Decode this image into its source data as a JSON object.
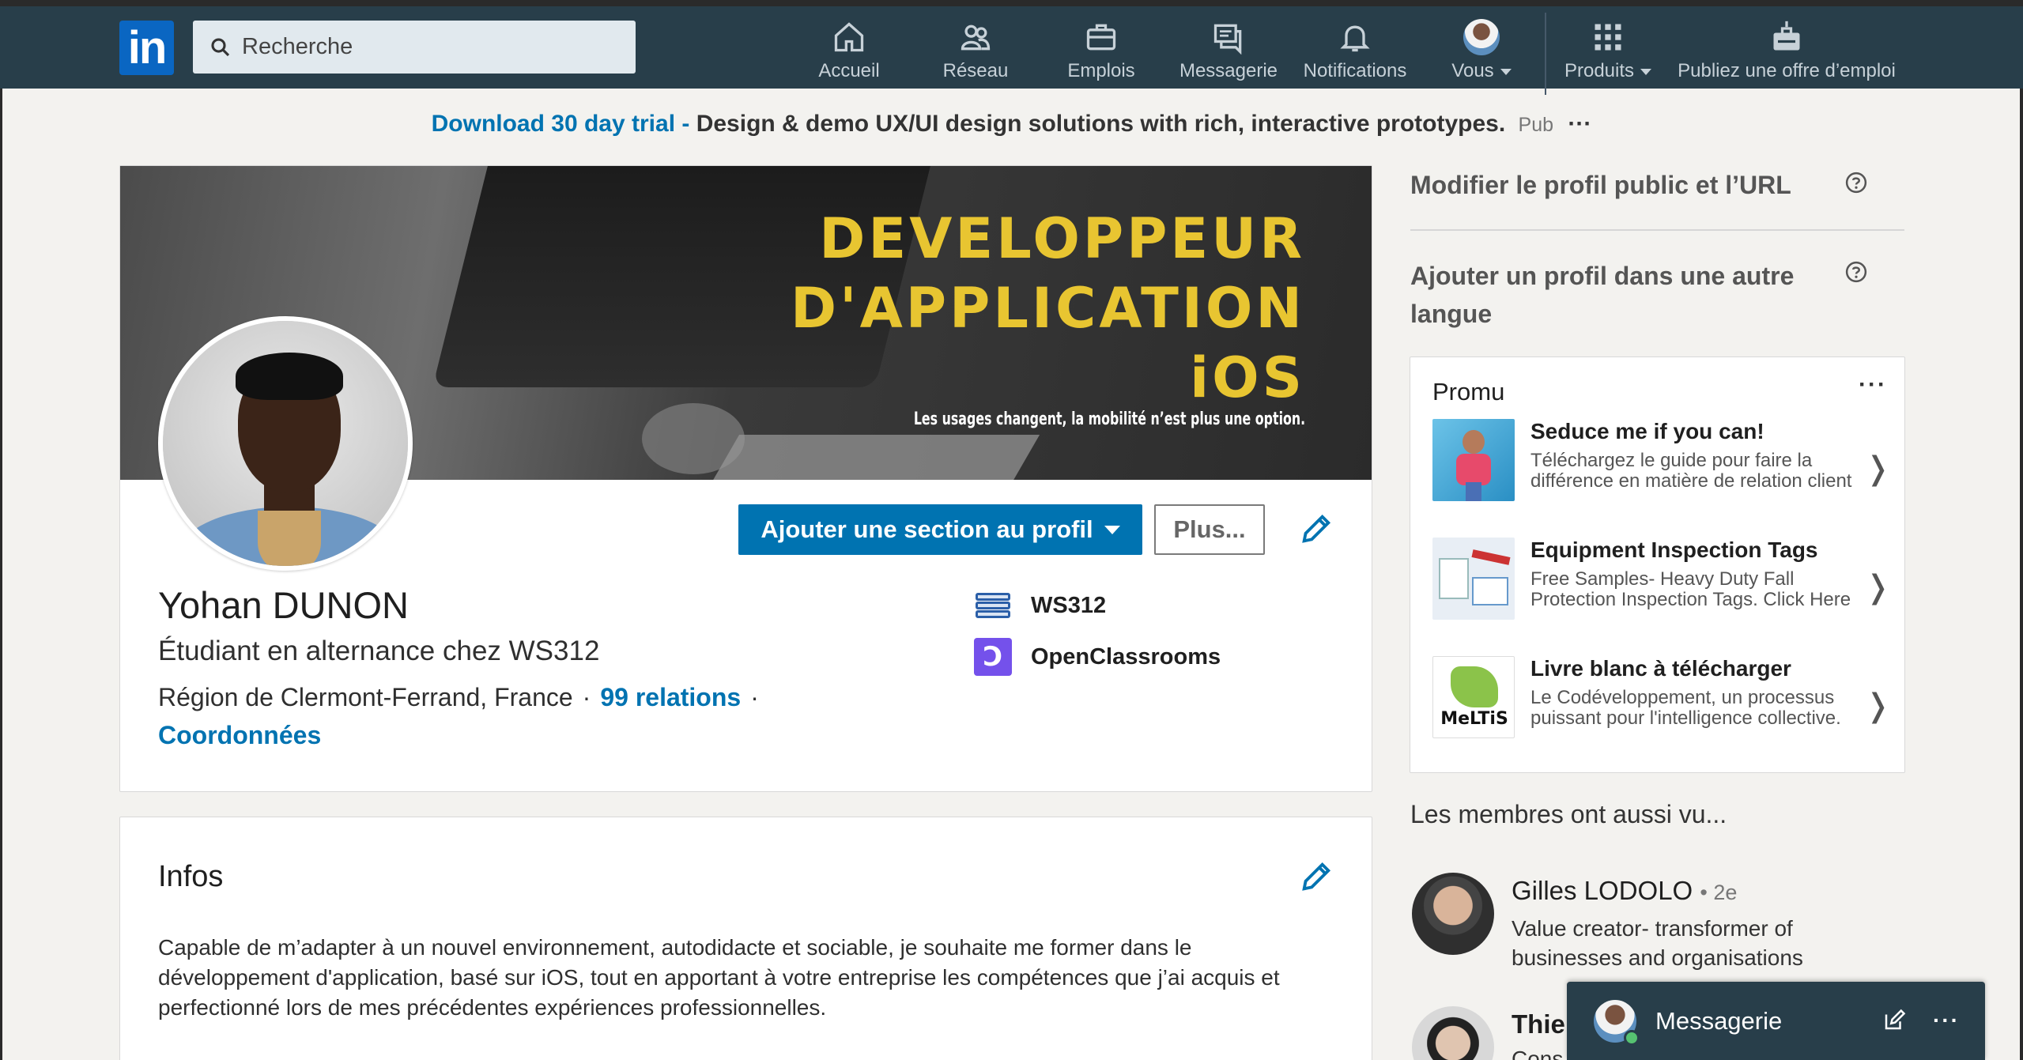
{
  "nav": {
    "logo_text": "in",
    "search_placeholder": "Recherche",
    "items": [
      {
        "label": "Accueil",
        "icon": "home-icon"
      },
      {
        "label": "Réseau",
        "icon": "network-icon"
      },
      {
        "label": "Emplois",
        "icon": "briefcase-icon"
      },
      {
        "label": "Messagerie",
        "icon": "messaging-icon"
      },
      {
        "label": "Notifications",
        "icon": "bell-icon"
      },
      {
        "label": "Vous",
        "icon": "avatar"
      },
      {
        "label": "Produits",
        "icon": "grid-icon"
      },
      {
        "label": "Publiez une offre d’emploi",
        "icon": "post-job-icon"
      }
    ]
  },
  "ad": {
    "link": "Download 30 day trial -",
    "text": "Design & demo UX/UI design solutions with rich, interactive prototypes.",
    "pub": "Pub",
    "dots": "···"
  },
  "profile": {
    "banner_title_1": "DEVELOPPEUR",
    "banner_title_2": "D'APPLICATION",
    "banner_title_3": "iOS",
    "banner_sub": "Les usages changent, la mobilité n’est plus une option.",
    "add_section_label": "Ajouter une section au profil",
    "more_label": "Plus...",
    "name": "Yohan DUNON",
    "headline": "Étudiant en alternance chez WS312",
    "location": "Région de Clermont-Ferrand, France",
    "relations": "99 relations",
    "sep": "·",
    "coordonnees": "Coordonnées",
    "orgs": [
      {
        "name": "WS312"
      },
      {
        "name": "OpenClassrooms",
        "logo_letter": "Ↄ"
      }
    ]
  },
  "infos": {
    "title": "Infos",
    "text": "Capable de m’adapter à un nouvel environnement, autodidacte et sociable, je souhaite me former dans le développement d'application, basé sur iOS, tout en apportant à votre entreprise les compétences que j’ai acquis et perfectionné lors de mes précédentes expériences professionnelles."
  },
  "rail": {
    "edit_public_profile": "Modifier le profil public et l’URL",
    "add_language_profile": "Ajouter un profil dans une autre langue",
    "promo": {
      "title": "Promu",
      "dots": "···",
      "items": [
        {
          "head": "Seduce me if you can!",
          "desc": "Téléchargez le guide pour faire la différence en matière de relation client",
          "chevron": "❭"
        },
        {
          "head": "Equipment Inspection Tags",
          "desc": "Free Samples- Heavy Duty Fall Protection Inspection Tags. Click Here",
          "chevron": "❭"
        },
        {
          "head": "Livre blanc à télécharger",
          "desc": "Le Codéveloppement, un processus puissant pour l'intelligence collective.",
          "chevron": "❭",
          "logo_text": "MeLTiS"
        }
      ]
    },
    "members_title": "Les membres ont aussi vu...",
    "members": [
      {
        "name": "Gilles LODOLO",
        "degree": "• 2e",
        "desc": "Value creator- transformer of businesses and organisations"
      },
      {
        "name": "Thier",
        "degree": "",
        "desc": "Cons"
      }
    ]
  },
  "dock": {
    "label": "Messagerie",
    "dots": "···"
  },
  "colors": {
    "nav_bg": "#283e4a",
    "brand_blue": "#0073b1",
    "banner_yellow": "#e8c531"
  }
}
